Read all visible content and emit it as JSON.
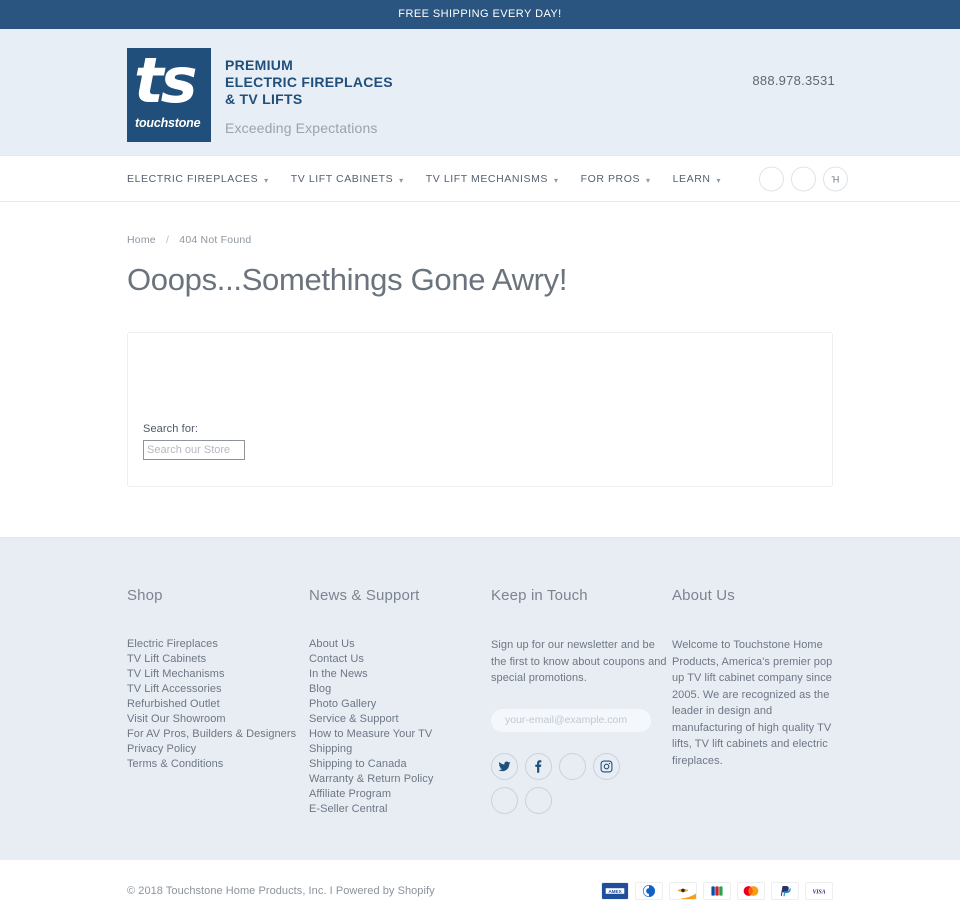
{
  "announcement": {
    "text": "FREE SHIPPING EVERY DAY!"
  },
  "header": {
    "logo": {
      "mark_text": "ts",
      "brand_text": "touchstone",
      "line1": "PREMIUM",
      "line2": "ELECTRIC FIREPLACES",
      "line3": "& TV LIFTS",
      "tagline": "Exceeding Expectations"
    },
    "phone": "888.978.3531"
  },
  "nav": {
    "items": [
      {
        "label": "ELECTRIC FIREPLACES",
        "caret": "▾"
      },
      {
        "label": "TV LIFT CABINETS",
        "caret": "▾"
      },
      {
        "label": "TV LIFT MECHANISMS",
        "caret": "▾"
      },
      {
        "label": "FOR PROS",
        "caret": "▾"
      },
      {
        "label": "LEARN",
        "caret": "▾"
      }
    ],
    "icons": [
      {
        "name": "search-icon",
        "glyph": ""
      },
      {
        "name": "account-icon",
        "glyph": ""
      },
      {
        "name": "cart-icon",
        "glyph": "Ή"
      }
    ]
  },
  "main": {
    "breadcrumb": {
      "home": "Home",
      "separator": "/",
      "current": "404 Not Found"
    },
    "title": "Ooops...Somethings Gone Awry!",
    "search": {
      "label": "Search for:",
      "placeholder": "Search our Store",
      "value": ""
    }
  },
  "footer": {
    "shop": {
      "title": "Shop",
      "links": [
        "Electric Fireplaces",
        "TV Lift Cabinets",
        "TV Lift Mechanisms",
        "TV Lift Accessories",
        "Refurbished Outlet",
        "Visit Our Showroom",
        "For AV Pros, Builders & Designers",
        "Privacy Policy",
        "Terms & Conditions"
      ]
    },
    "news": {
      "title": "News & Support",
      "links": [
        "About Us",
        "Contact Us",
        "In the News",
        "Blog",
        "Photo Gallery",
        "Service & Support",
        "How to Measure Your TV",
        "Shipping",
        "Shipping to Canada",
        "Warranty & Return Policy",
        "Affiliate Program",
        "E-Seller Central"
      ]
    },
    "keep_in_touch": {
      "title": "Keep in Touch",
      "description": "Sign up for our newsletter and be the first to know about coupons and special promotions.",
      "email_placeholder": "your-email@example.com",
      "email_value": "",
      "socials": [
        {
          "name": "twitter-icon"
        },
        {
          "name": "facebook-icon"
        },
        {
          "name": "pinterest-icon"
        },
        {
          "name": "instagram-icon"
        },
        {
          "name": "youtube-icon"
        },
        {
          "name": "rss-icon"
        }
      ]
    },
    "about": {
      "title": "About Us",
      "description": "Welcome to Touchstone Home Products, America's premier pop up TV lift cabinet company since 2005. We are recognized as the leader in design and manufacturing of high quality TV lifts, TV lift cabinets and electric fireplaces."
    }
  },
  "bottom": {
    "copyright": "© 2018 Touchstone Home Products, Inc. I Powered by Shopify",
    "payments": [
      {
        "name": "amex-icon",
        "label": "AMEX"
      },
      {
        "name": "diners-club-icon",
        "label": "Diners Club"
      },
      {
        "name": "discover-icon",
        "label": "Discover"
      },
      {
        "name": "jcb-icon",
        "label": "JCB"
      },
      {
        "name": "mastercard-icon",
        "label": "Mastercard"
      },
      {
        "name": "paypal-icon",
        "label": "PayPal"
      },
      {
        "name": "visa-icon",
        "label": "VISA"
      }
    ]
  },
  "colors": {
    "announce_bg": "#2a5580",
    "header_bg": "#e8eef6",
    "brand_blue": "#1f4f7a",
    "footer_bg": "#e8edf4",
    "text": "#6d7784"
  }
}
